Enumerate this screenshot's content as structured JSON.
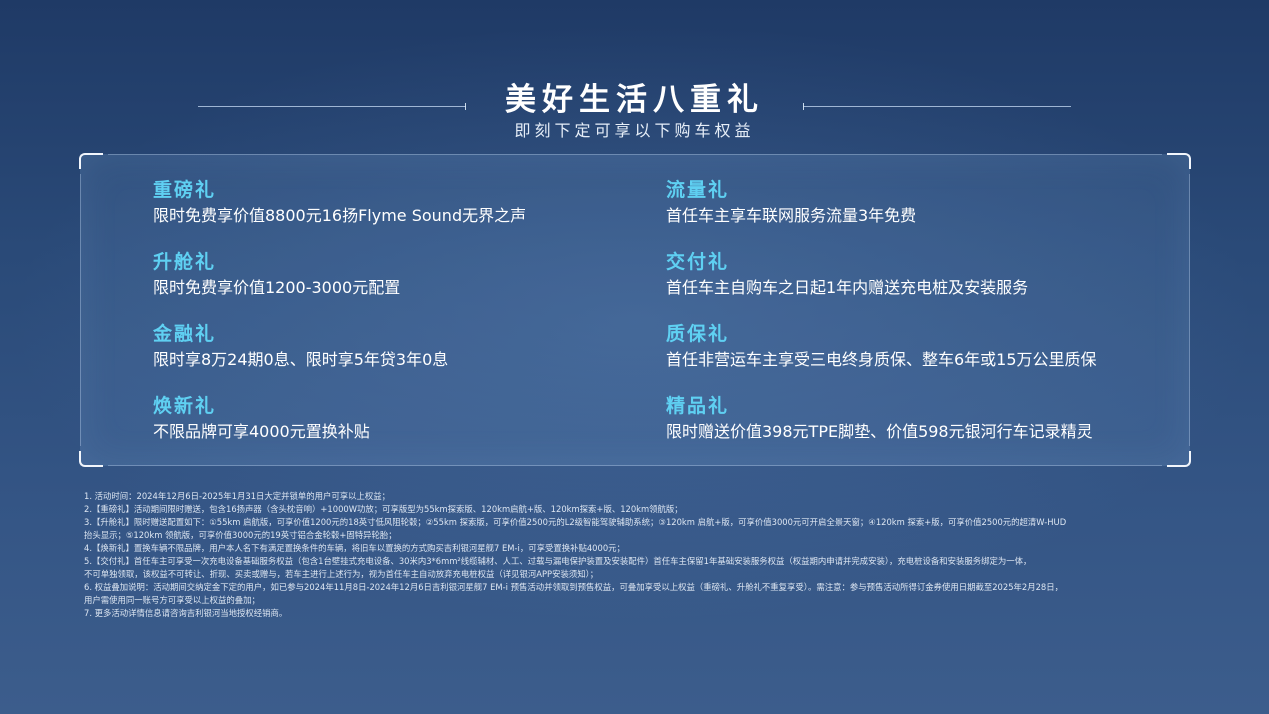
{
  "header": {
    "title": "美好生活八重礼",
    "subtitle": "即刻下定可享以下购车权益"
  },
  "gifts": [
    {
      "name": "重磅礼",
      "desc": "限时免费享价值8800元16扬Flyme Sound无界之声"
    },
    {
      "name": "升舱礼",
      "desc": "限时免费享价值1200-3000元配置"
    },
    {
      "name": "金融礼",
      "desc": "限时享8万24期0息、限时享5年贷3年0息"
    },
    {
      "name": "焕新礼",
      "desc": "不限品牌可享4000元置换补贴"
    },
    {
      "name": "流量礼",
      "desc": "首任车主享车联网服务流量3年免费"
    },
    {
      "name": "交付礼",
      "desc": "首任车主自购车之日起1年内赠送充电桩及安装服务"
    },
    {
      "name": "质保礼",
      "desc": "首任非营运车主享受三电终身质保、整车6年或15万公里质保"
    },
    {
      "name": "精品礼",
      "desc": "限时赠送价值398元TPE脚垫、价值598元银河行车记录精灵"
    }
  ],
  "notes": [
    "1. 活动时间：2024年12月6日-2025年1月31日大定并锁单的用户可享以上权益；",
    "2.【重磅礼】活动期间限时赠送，包含16扬声器（含头枕音响）+1000W功放；可享版型为55km探索版、120km启航+版、120km探索+版、120km领航版；",
    "3.【升舱礼】限时赠送配置如下：①55km 启航版，可享价值1200元的18英寸低风阻轮毂；②55km 探索版，可享价值2500元的L2级智能驾驶辅助系统；③120km 启航+版，可享价值3000元可开启全景天窗；④120km 探索+版，可享价值2500元的超清W-HUD",
    "抬头显示；⑤120km 领航版，可享价值3000元的19英寸铝合金轮毂+固特异轮胎；",
    "4.【焕新礼】置换车辆不限品牌，用户本人名下有满足置换条件的车辆，将旧车以置换的方式购买吉利银河星舰7 EM-i，可享受置换补贴4000元；",
    "5.【交付礼】首任车主可享受一次充电设备基础服务权益（包含1台壁挂式充电设备、30米内3*6mm²线缆辅材、人工、过载与漏电保护装置及安装配件）首任车主保留1年基础安装服务权益（权益期内申请并完成安装），充电桩设备和安装服务绑定为一体，",
    "不可单独领取，该权益不可转让、折现、买卖或赠与，若车主进行上述行为，视为首任车主自动放弃充电桩权益（详见银河APP安装须知）；",
    "6. 权益叠加说明：活动期间交纳定金下定的用户，如已参与2024年11月8日-2024年12月6日吉利银河星舰7 EM-i 预售活动并领取到预售权益，可叠加享受以上权益（重磅礼、升舱礼不重复享受）。需注意：参与预售活动所得订金券使用日期截至2025年2月28日，",
    "用户需使用同一账号方可享受以上权益的叠加；",
    "7. 更多活动详情信息请咨询吉利银河当地授权经销商。"
  ],
  "colors": {
    "background_top": "#1f3a66",
    "background_bottom": "#3c5d8c",
    "gift_name": "#5fd0f2",
    "text": "#ffffff"
  }
}
